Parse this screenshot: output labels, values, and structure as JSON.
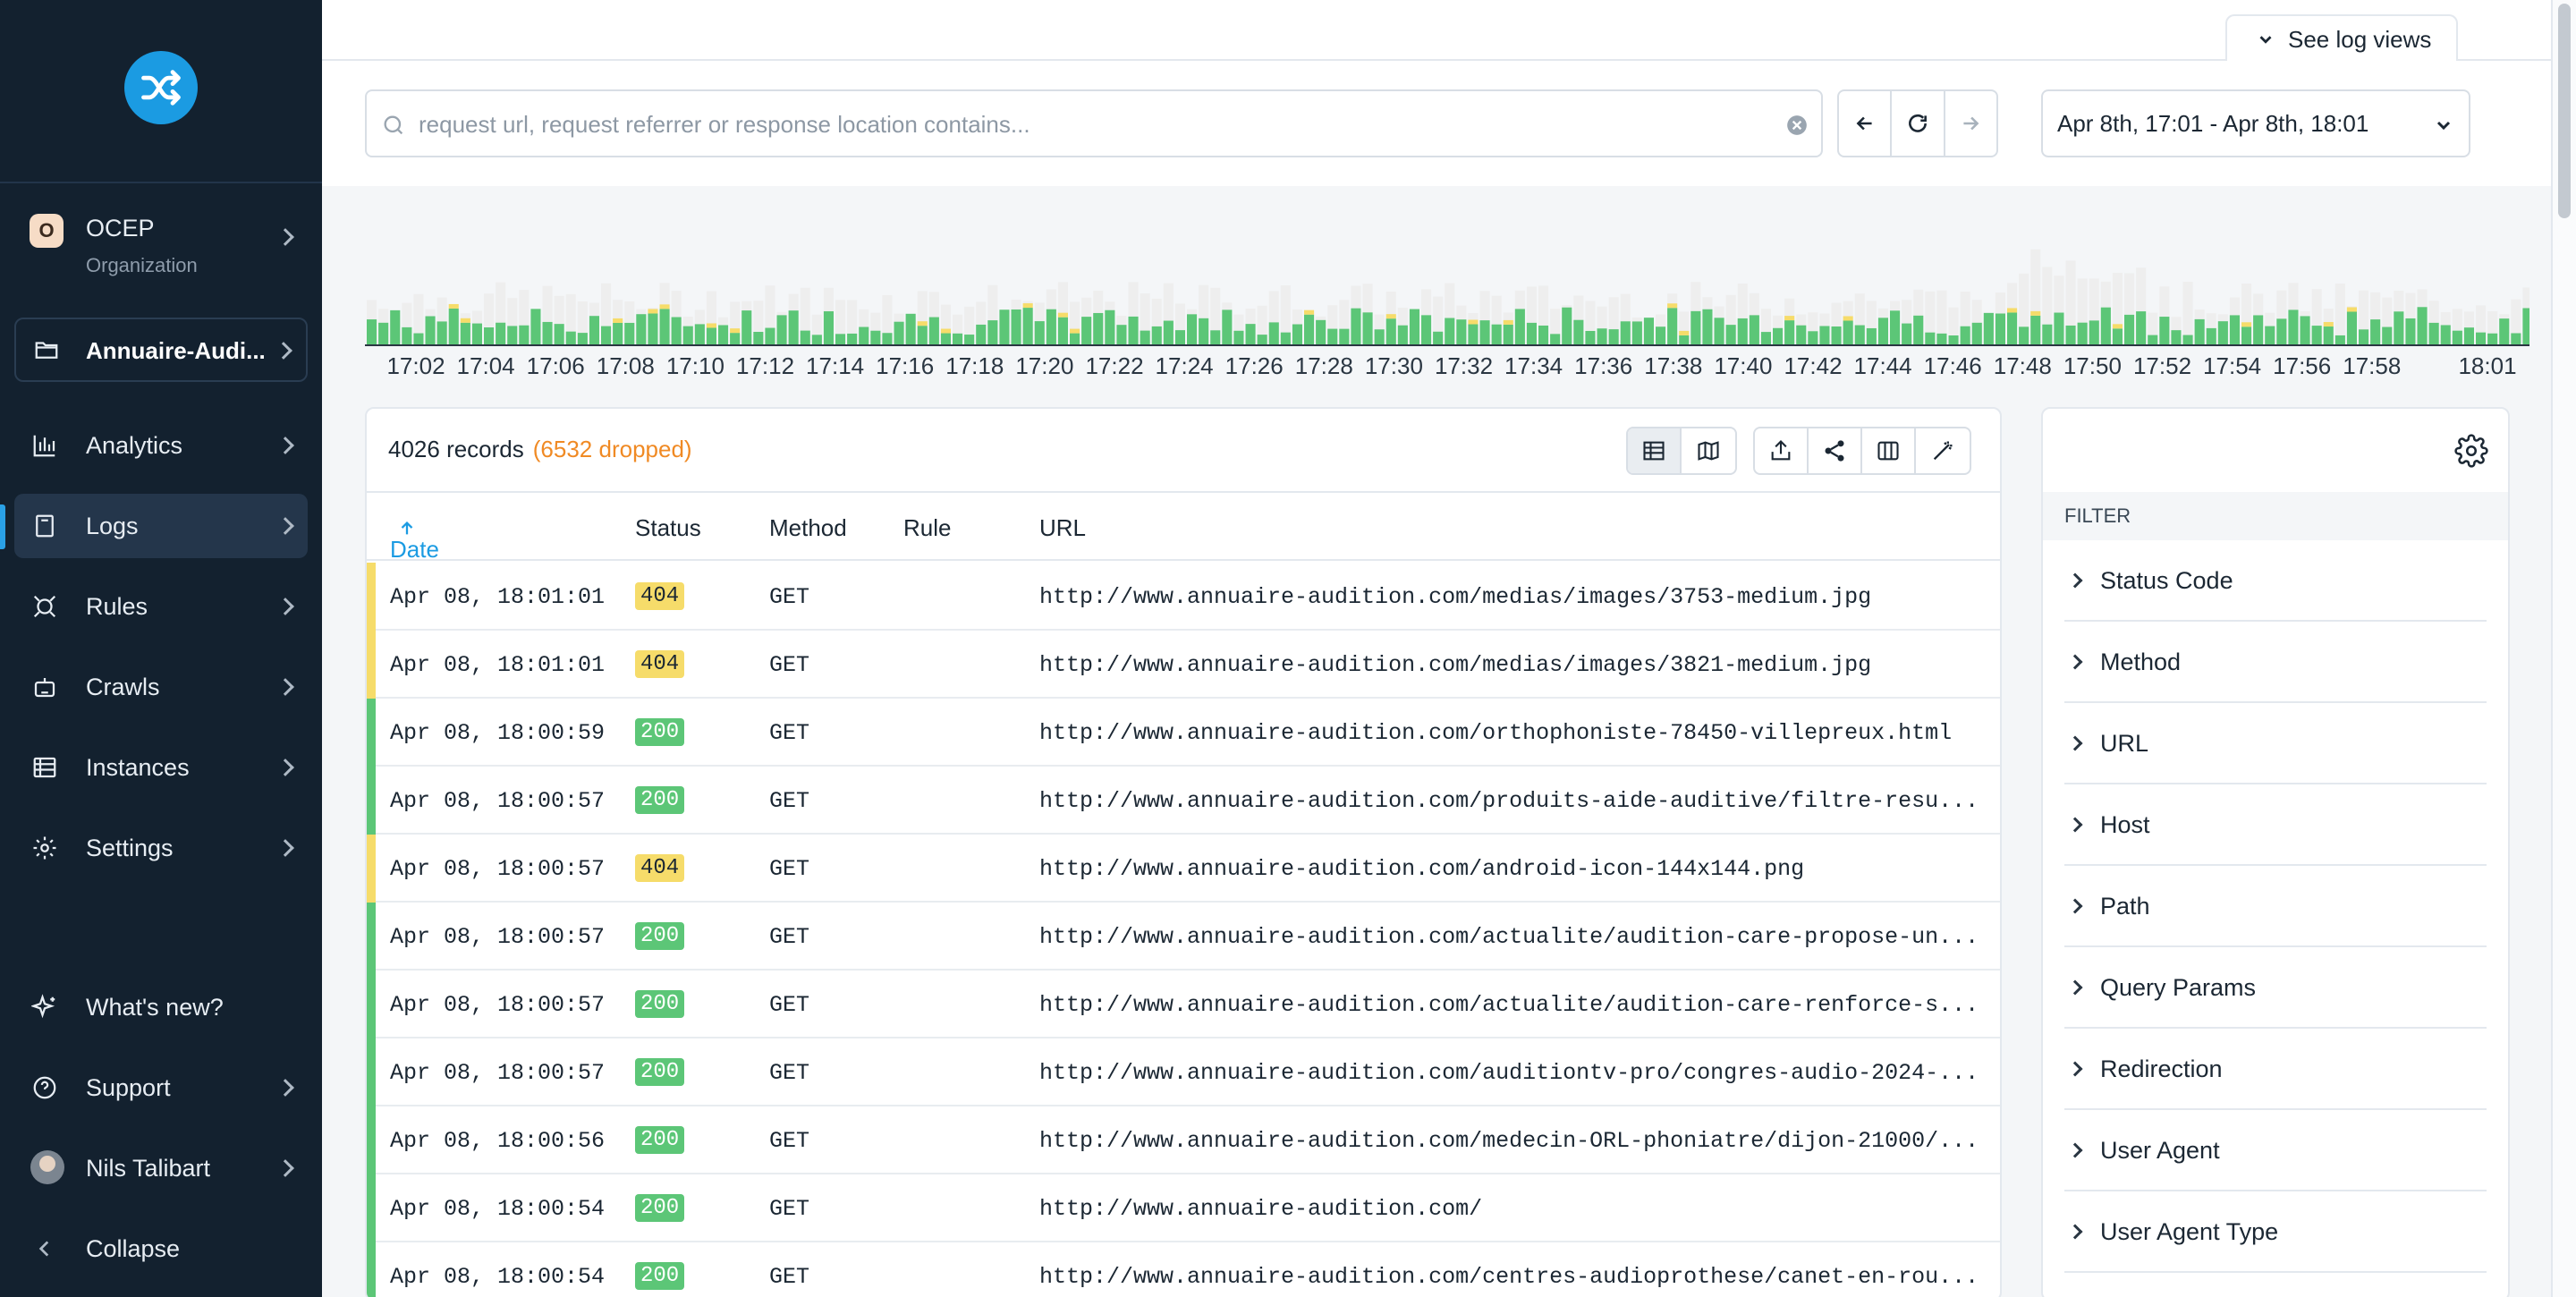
{
  "sidebar": {
    "org": {
      "initial": "O",
      "name": "OCEP",
      "subtitle": "Organization"
    },
    "project": {
      "name": "Annuaire-Audi..."
    },
    "items": [
      {
        "label": "Analytics",
        "icon": "analytics-icon"
      },
      {
        "label": "Logs",
        "icon": "logs-icon"
      },
      {
        "label": "Rules",
        "icon": "rules-icon"
      },
      {
        "label": "Crawls",
        "icon": "crawls-icon"
      },
      {
        "label": "Instances",
        "icon": "instances-icon"
      },
      {
        "label": "Settings",
        "icon": "settings-icon"
      }
    ],
    "bottom": [
      {
        "label": "What's new?",
        "icon": "sparkle-icon"
      },
      {
        "label": "Support",
        "icon": "help-icon"
      },
      {
        "label": "Nils Talibart",
        "icon": "avatar"
      },
      {
        "label": "Collapse",
        "icon": "chevron-left-icon"
      }
    ]
  },
  "topbar": {
    "log_views_label": "See log views"
  },
  "search": {
    "placeholder": "request url, request referrer or response location contains...",
    "value": ""
  },
  "date_range": {
    "value": "Apr 8th, 17:01 - Apr 8th, 18:01"
  },
  "histogram": {
    "ticks": [
      "17:02",
      "17:04",
      "17:06",
      "17:08",
      "17:10",
      "17:12",
      "17:14",
      "17:16",
      "17:18",
      "17:20",
      "17:22",
      "17:24",
      "17:26",
      "17:28",
      "17:30",
      "17:32",
      "17:34",
      "17:36",
      "17:38",
      "17:40",
      "17:42",
      "17:44",
      "17:46",
      "17:48",
      "17:50",
      "17:52",
      "17:54",
      "17:56",
      "17:58",
      "18:01"
    ],
    "colors": {
      "ok": "#5cc677",
      "warn": "#f6dc6a",
      "dropped": "#eeeeee"
    }
  },
  "records": {
    "count": "4026 records",
    "dropped": "(6532 dropped)",
    "columns": {
      "date": "Date",
      "status": "Status",
      "method": "Method",
      "rule": "Rule",
      "url": "URL"
    },
    "rows": [
      {
        "date": "Apr 08, 18:01:01",
        "status": "404",
        "method": "GET",
        "url": "http://www.annuaire-audition.com/medias/images/3753-medium.jpg"
      },
      {
        "date": "Apr 08, 18:01:01",
        "status": "404",
        "method": "GET",
        "url": "http://www.annuaire-audition.com/medias/images/3821-medium.jpg"
      },
      {
        "date": "Apr 08, 18:00:59",
        "status": "200",
        "method": "GET",
        "url": "http://www.annuaire-audition.com/orthophoniste-78450-villepreux.html"
      },
      {
        "date": "Apr 08, 18:00:57",
        "status": "200",
        "method": "GET",
        "url": "http://www.annuaire-audition.com/produits-aide-auditive/filtre-resu..."
      },
      {
        "date": "Apr 08, 18:00:57",
        "status": "404",
        "method": "GET",
        "url": "http://www.annuaire-audition.com/android-icon-144x144.png"
      },
      {
        "date": "Apr 08, 18:00:57",
        "status": "200",
        "method": "GET",
        "url": "http://www.annuaire-audition.com/actualite/audition-care-propose-un..."
      },
      {
        "date": "Apr 08, 18:00:57",
        "status": "200",
        "method": "GET",
        "url": "http://www.annuaire-audition.com/actualite/audition-care-renforce-s..."
      },
      {
        "date": "Apr 08, 18:00:57",
        "status": "200",
        "method": "GET",
        "url": "http://www.annuaire-audition.com/auditiontv-pro/congres-audio-2024-..."
      },
      {
        "date": "Apr 08, 18:00:56",
        "status": "200",
        "method": "GET",
        "url": "http://www.annuaire-audition.com/medecin-ORL-phoniatre/dijon-21000/..."
      },
      {
        "date": "Apr 08, 18:00:54",
        "status": "200",
        "method": "GET",
        "url": "http://www.annuaire-audition.com/"
      },
      {
        "date": "Apr 08, 18:00:54",
        "status": "200",
        "method": "GET",
        "url": "http://www.annuaire-audition.com/centres-audioprothese/canet-en-rou..."
      }
    ]
  },
  "filters": {
    "title": "FILTER",
    "items": [
      "Status Code",
      "Method",
      "URL",
      "Host",
      "Path",
      "Query Params",
      "Redirection",
      "User Agent",
      "User Agent Type"
    ]
  },
  "colors": {
    "accent": "#1b9be2",
    "ok_badge": "#5cc677",
    "warn_badge": "#f6dc6a",
    "dropped_text": "#f08a24"
  }
}
